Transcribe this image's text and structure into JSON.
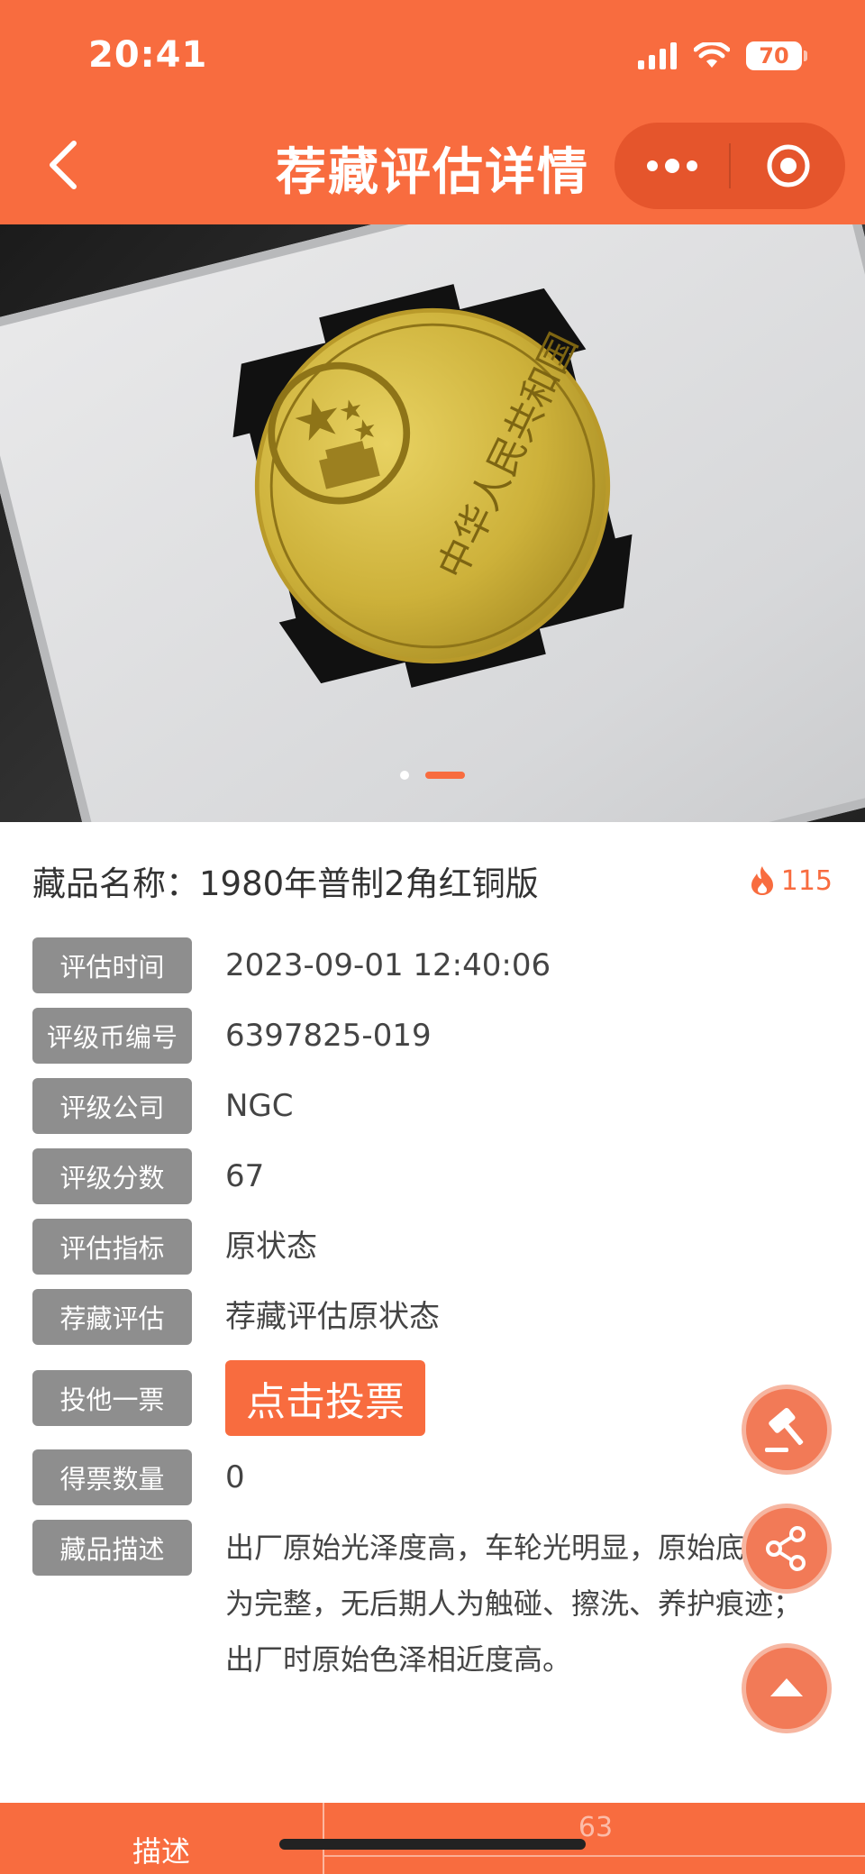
{
  "status_bar": {
    "time": "20:41",
    "battery": "70"
  },
  "nav": {
    "title": "荐藏评估详情"
  },
  "banner": {
    "coin_legend": "中华人民共和国",
    "slide_count": 2,
    "active_slide": 2
  },
  "item": {
    "name_label": "藏品名称：",
    "name": "1980年普制2角红铜版",
    "hot_count": "115"
  },
  "details": [
    {
      "label": "评估时间",
      "value": "2023-09-01 12:40:06"
    },
    {
      "label": "评级币编号",
      "value": "6397825-019"
    },
    {
      "label": "评级公司",
      "value": "NGC"
    },
    {
      "label": "评级分数",
      "value": "67"
    },
    {
      "label": "评估指标",
      "value": "原状态"
    },
    {
      "label": "荐藏评估",
      "value": "荐藏评估原状态"
    }
  ],
  "vote": {
    "label": "投他一票",
    "button": "点击投票"
  },
  "votes": {
    "label": "得票数量",
    "value": "0"
  },
  "description": {
    "label": "藏品描述",
    "text": "出厂原始光泽度高，车轮光明显，原始底光较为完整，无后期人为触碰、擦洗、养护痕迹；出厂时原始色泽相近度高。"
  },
  "bottom": {
    "tab_label": "描述",
    "count": "63"
  },
  "colors": {
    "accent": "#f86c3f",
    "tag_bg": "#8e8e8e"
  },
  "icons": [
    "back-chevron-icon",
    "more-dots-icon",
    "target-icon",
    "fire-icon",
    "gavel-icon",
    "share-icon",
    "arrow-up-icon"
  ]
}
